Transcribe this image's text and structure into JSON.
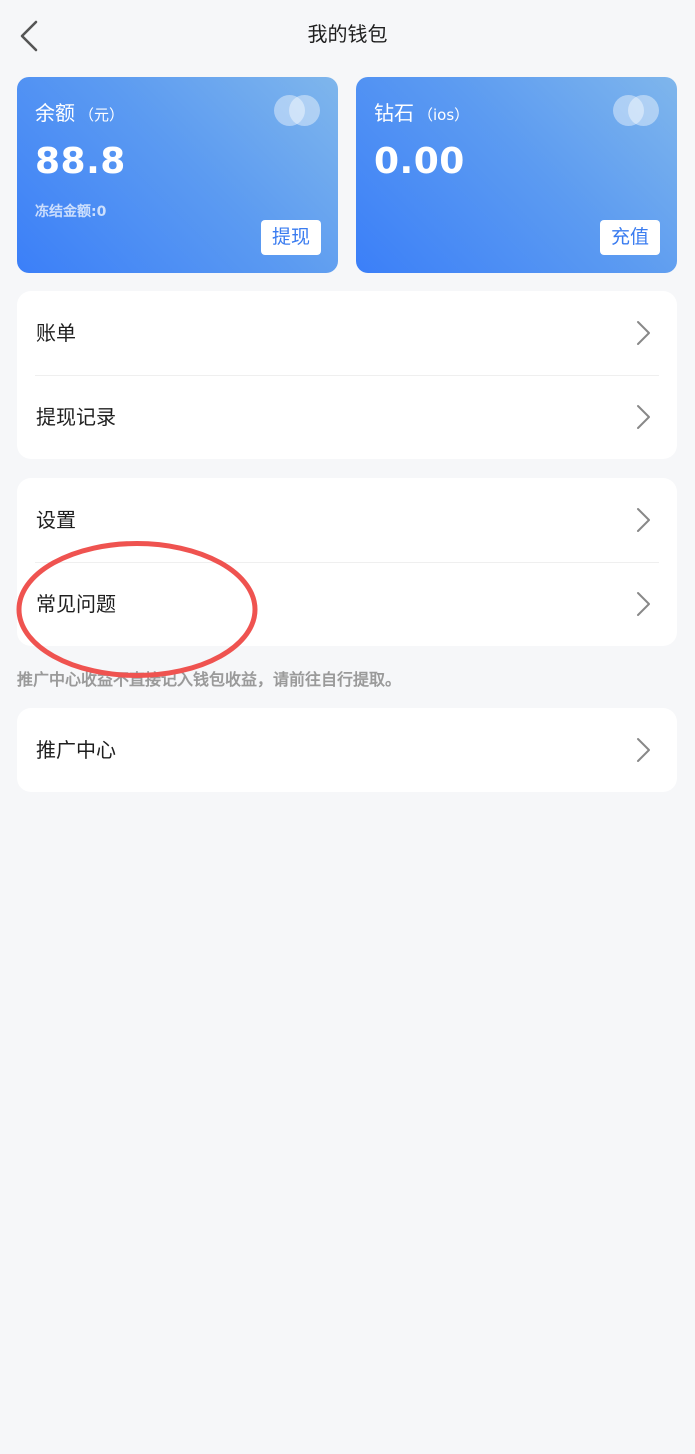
{
  "header": {
    "title": "我的钱包"
  },
  "balance_card": {
    "label": "余额",
    "unit": "（元）",
    "amount": "88.8",
    "frozen": "冻结金额:0",
    "button": "提现"
  },
  "diamond_card": {
    "label": "钻石",
    "unit": "（ios）",
    "amount": "0.00",
    "button": "充值"
  },
  "list1": {
    "items": [
      {
        "label": "账单"
      },
      {
        "label": "提现记录"
      }
    ]
  },
  "list2": {
    "items": [
      {
        "label": "设置"
      },
      {
        "label": "常见问题"
      }
    ]
  },
  "note": "推广中心收益不直接记入钱包收益，请前往自行提取。",
  "list3": {
    "items": [
      {
        "label": "推广中心"
      }
    ]
  },
  "colors": {
    "card_gradient_start": "#3b7ff8",
    "card_gradient_end": "#7fb6ec",
    "button_text": "#3a7cf0",
    "annotation": "#ef5350",
    "background": "#f6f7f9"
  }
}
